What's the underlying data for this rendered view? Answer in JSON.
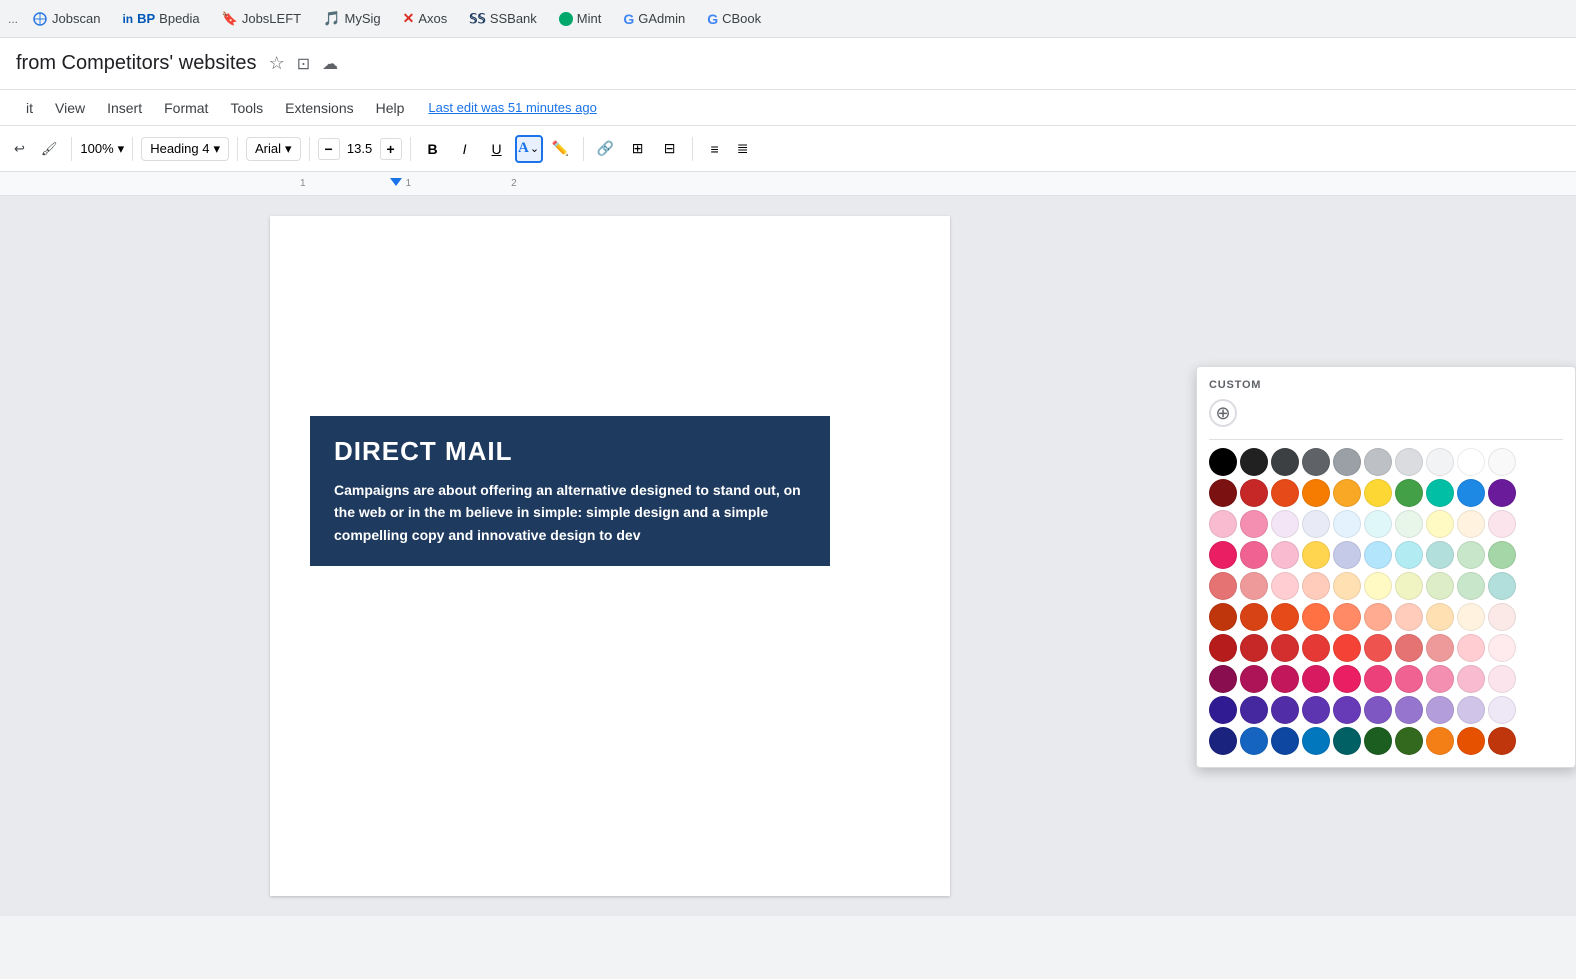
{
  "bookmarks": {
    "items": [
      {
        "label": "Jobscan",
        "icon_color": "#2c7be5",
        "icon_type": "globe"
      },
      {
        "label": "BP",
        "icon_color": "#0057b7",
        "icon_type": "square"
      },
      {
        "label": "Bpedia",
        "icon_color": "#1a73e8",
        "icon_type": "bookmark"
      },
      {
        "label": "JobsLEFT",
        "icon_color": "#e37400",
        "icon_type": "bookmark"
      },
      {
        "label": "MySig",
        "icon_color": "#1a73e8",
        "icon_type": "circle"
      },
      {
        "label": "Axos",
        "icon_color": "#d93025",
        "icon_type": "x"
      },
      {
        "label": "SSBank",
        "icon_color": "#1e3a5f",
        "icon_type": "bank"
      },
      {
        "label": "Mint",
        "icon_color": "#00a86b",
        "icon_type": "dot"
      },
      {
        "label": "GAdmin",
        "icon_color": "#4285f4",
        "icon_type": "g"
      },
      {
        "label": "CBook",
        "icon_color": "#4285f4",
        "icon_type": "g"
      }
    ]
  },
  "document": {
    "title": "from Competitors' websites",
    "last_edit": "Last edit was 51 minutes ago"
  },
  "menu": {
    "items": [
      "it",
      "View",
      "Insert",
      "Format",
      "Tools",
      "Extensions",
      "Help"
    ]
  },
  "toolbar": {
    "zoom": "100%",
    "heading": "Heading 4",
    "font": "Arial",
    "font_size": "13.5",
    "bold_label": "B",
    "italic_label": "I",
    "underline_label": "U",
    "decrease_label": "−",
    "increase_label": "+"
  },
  "color_picker": {
    "section_title": "CUSTOM",
    "add_label": "+",
    "colors_row1": [
      "#000000",
      "#212121",
      "#3c4043",
      "#5f6368",
      "#9aa0a6",
      "#bdc1c6",
      "#dadce0",
      "#f1f3f4",
      "#ffffff",
      "#f9f9f9"
    ],
    "colors_row2": [
      "#7b1111",
      "#c62828",
      "#e64a19",
      "#f57c00",
      "#f9a825",
      "#fdd835",
      "#43a047",
      "#00bfa5",
      "#1e88e5",
      "#6a1b9a"
    ],
    "colors_row3": [
      "#f8bbd0",
      "#f48fb1",
      "#f3e5f5",
      "#e8eaf6",
      "#e3f2fd",
      "#e0f7fa",
      "#e8f5e9",
      "#fff9c4",
      "#fff3e0",
      "#fce4ec"
    ],
    "colors_row4": [
      "#e91e63",
      "#f06292",
      "#f8bbd0",
      "#ffd54f",
      "#c5cae9",
      "#b3e5fc",
      "#b2ebf2",
      "#b2dfdb",
      "#c8e6c9",
      "#a5d6a7"
    ],
    "colors_row5": [
      "#e57373",
      "#ef9a9a",
      "#ffcdd2",
      "#ffccbc",
      "#ffe0b2",
      "#fff9c4",
      "#f0f4c3",
      "#dcedc8",
      "#c8e6c9",
      "#b2dfdb"
    ],
    "colors_row6": [
      "#bf360c",
      "#d84315",
      "#e64a19",
      "#ff7043",
      "#ff8a65",
      "#ffab91",
      "#ffccbc",
      "#ffe0b2",
      "#fff3e0",
      "#fbe9e7"
    ],
    "colors_row7": [
      "#b71c1c",
      "#c62828",
      "#d32f2f",
      "#e53935",
      "#f44336",
      "#ef5350",
      "#e57373",
      "#ef9a9a",
      "#ffcdd2",
      "#ffebee"
    ],
    "colors_row8": [
      "#880e4f",
      "#ad1457",
      "#c2185b",
      "#d81b60",
      "#e91e63",
      "#ec407a",
      "#f06292",
      "#f48fb1",
      "#f8bbd0",
      "#fce4ec"
    ],
    "colors_row9": [
      "#311b92",
      "#4527a0",
      "#512da8",
      "#5e35b1",
      "#673ab7",
      "#7e57c2",
      "#9575cd",
      "#b39ddb",
      "#d1c4e9",
      "#ede7f6"
    ],
    "colors_row10": [
      "#1a237e",
      "#1565c0",
      "#0d47a1",
      "#0277bd",
      "#006064",
      "#1b5e20",
      "#33691e",
      "#f57f17",
      "#e65100",
      "#bf360c"
    ]
  },
  "direct_mail": {
    "title": "DIRECT MAIL",
    "text": "Campaigns are about offering an alternative designed to stand out, on the web or in the m believe in simple: simple design and a simple compelling copy and innovative design to dev"
  }
}
